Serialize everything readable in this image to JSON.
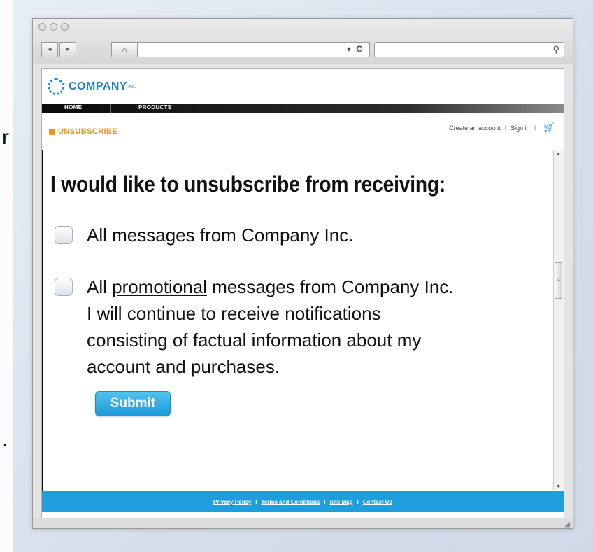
{
  "page_edge_chars": [
    "r",
    "."
  ],
  "browser": {
    "traffic_lights": [
      "close",
      "minimize",
      "zoom"
    ],
    "back_symbol": "◂",
    "forward_symbol": "▸",
    "home_symbol": "⌂",
    "dropdown_symbol": "▾",
    "reload_symbol": "C",
    "loading_symbol": "☼",
    "search_symbol": "⚲",
    "resize_grip_symbol": "◢"
  },
  "site": {
    "logo_text": "COMPANY",
    "logo_suffix": "Inc.",
    "nav": [
      "HOME",
      "PRODUCTS"
    ],
    "section_label": "UNSUBSCRIBE",
    "account_links": [
      "Create an account",
      "Sign in"
    ],
    "account_sep": "I"
  },
  "form": {
    "heading": "I would like to unsubscribe from receiving:",
    "option1": "All messages from Company Inc.",
    "option2_prefix": "All ",
    "option2_underlined": "promotional",
    "option2_suffix": " messages from Company Inc.",
    "option2_lines": [
      "I will continue to receive notifications",
      "consisting of factual information about my",
      "account and purchases."
    ],
    "submit_label": "Submit"
  },
  "scrollbar": {
    "up_symbol": "▲",
    "down_symbol": "▼",
    "thumb_grip": "≡"
  },
  "footer": {
    "links": [
      "Privacy Policy",
      "Terms and Conditions",
      "Site Map",
      "Contact Us"
    ],
    "sep": "I"
  },
  "colors": {
    "accent": "#1e9fdb",
    "label_orange": "#e89414",
    "logo_blue": "#1f85c9"
  }
}
